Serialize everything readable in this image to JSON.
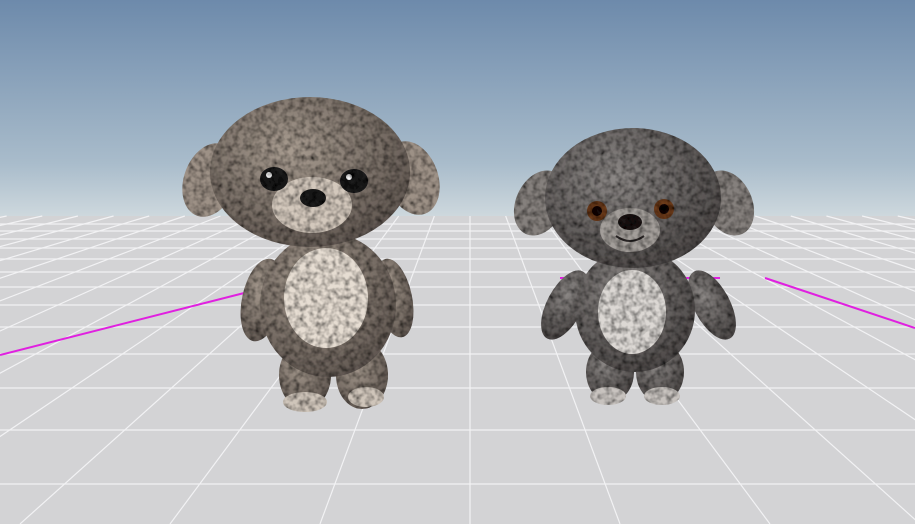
{
  "scene": {
    "colors": {
      "sky_top": "#6d8aab",
      "sky_horizon": "#c9d5dc",
      "floor": "#d3d3d5",
      "grid_line": "#f4f4f6",
      "axis_line": "#e020e0",
      "left_dog_fur": "#8a7f76",
      "left_dog_belly": "#e6ddd2",
      "right_dog_fur": "#6f6a68",
      "right_dog_belly": "#dcd8d4"
    },
    "objects": [
      {
        "name": "left-plush-dog",
        "eye_color": "#1a1a1e"
      },
      {
        "name": "right-plush-dog",
        "eye_color": "#6a3a1c"
      }
    ]
  }
}
